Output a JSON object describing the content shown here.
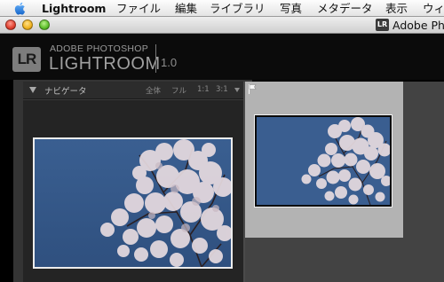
{
  "menubar": {
    "app_name": "Lightroom",
    "items": [
      "ファイル",
      "編集",
      "ライブラリ",
      "写真",
      "メタデータ",
      "表示",
      "ウィ"
    ]
  },
  "window": {
    "icon_label": "LR",
    "title": "Adobe Pho"
  },
  "branding": {
    "logo": "LR",
    "company": "ADOBE PHOTOSHOP",
    "product": "LIGHTROOM",
    "version": "1.0"
  },
  "navigator": {
    "title": "ナビゲータ",
    "zoom_options": [
      "全体",
      "フル",
      "1:1",
      "3:1"
    ],
    "preview_alt": "Cherry blossom tree against blue sky"
  },
  "grid": {
    "thumbnail_alt": "Cherry blossom tree against blue sky"
  },
  "colors": {
    "sky": "#355a8c",
    "blossom": "#e9dde2",
    "header_bg": "#0b0b0b"
  }
}
